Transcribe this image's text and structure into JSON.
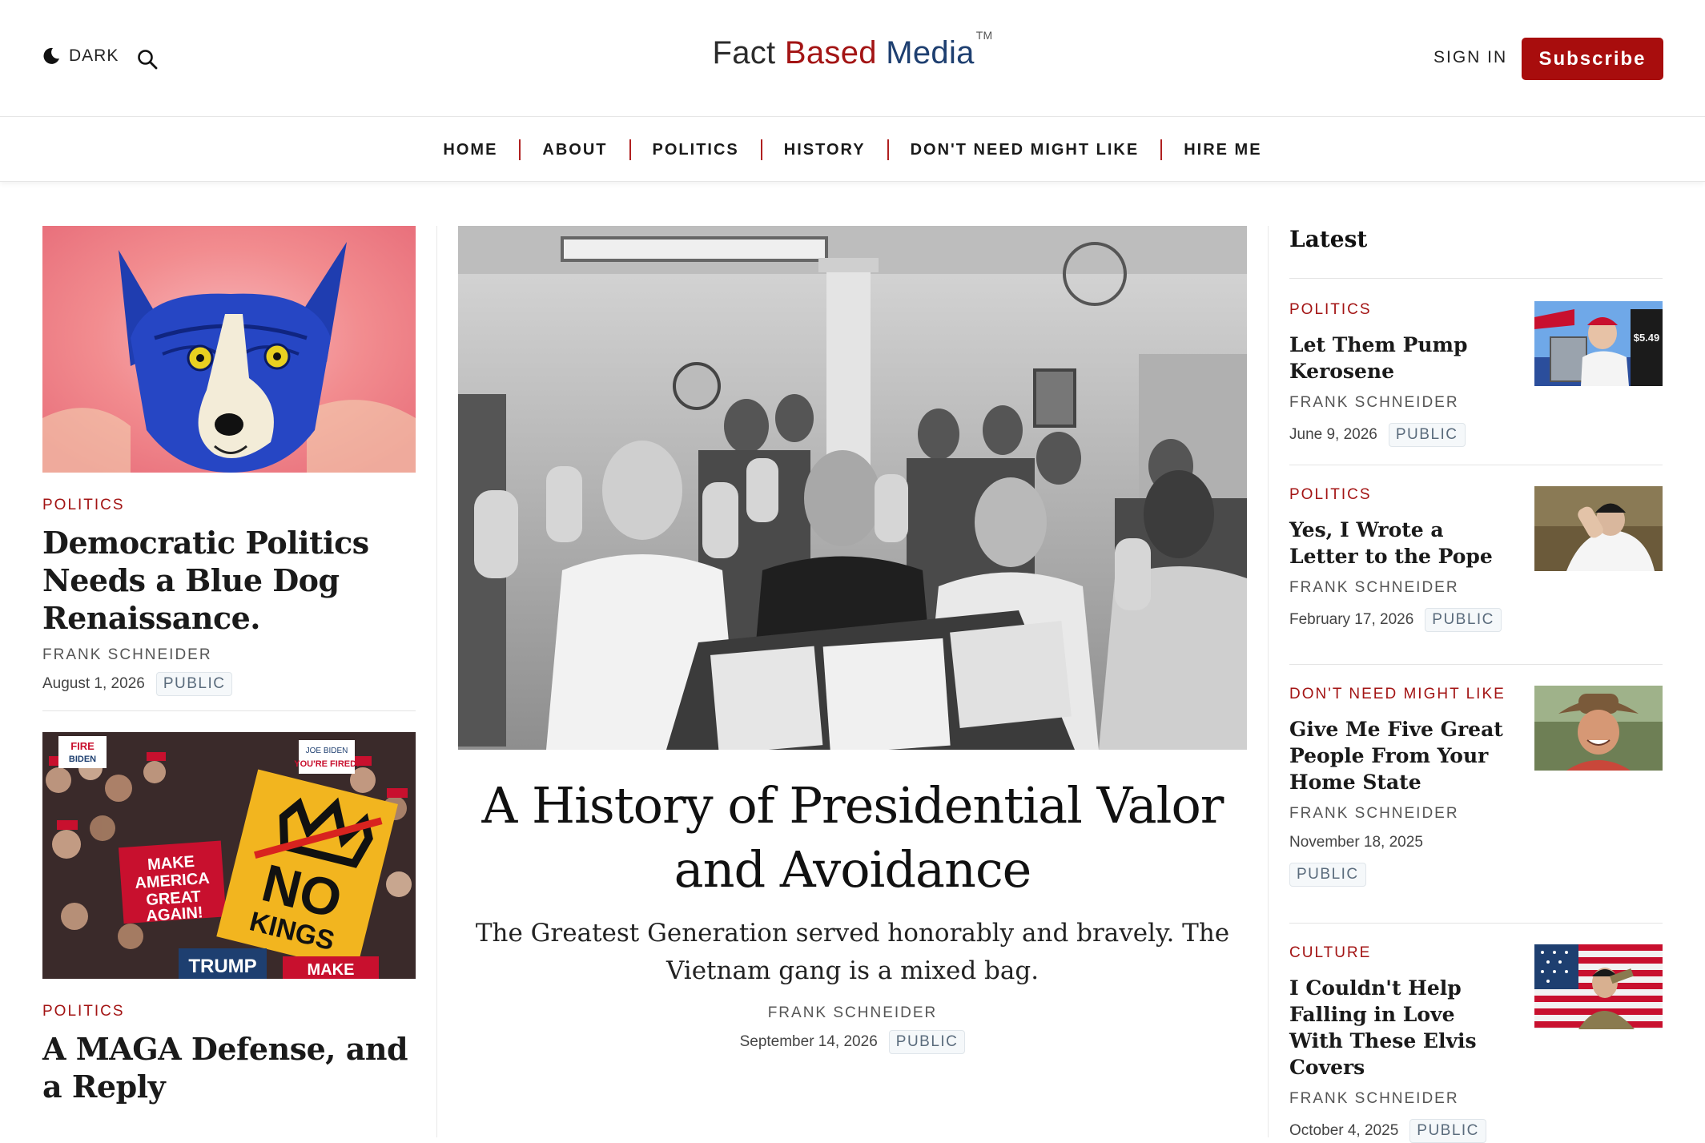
{
  "header": {
    "dark_label": "DARK",
    "logo": {
      "word1": "Fact",
      "word2": "Based",
      "word3": "Media",
      "mark": "TM"
    },
    "signin_label": "SIGN IN",
    "subscribe_label": "Subscribe"
  },
  "nav": [
    "HOME",
    "ABOUT",
    "POLITICS",
    "HISTORY",
    "DON'T NEED MIGHT LIKE",
    "HIRE ME"
  ],
  "left_articles": [
    {
      "category": "POLITICS",
      "title": "Democratic Politics Needs a Blue Dog Renaissance.",
      "author": "FRANK SCHNEIDER",
      "date": "August 1, 2026",
      "badge": "PUBLIC"
    },
    {
      "category": "POLITICS",
      "title": "A MAGA Defense, and a Reply"
    }
  ],
  "sign_text": {
    "fire": "FIRE",
    "biden": "BIDEN",
    "joe_biden": "JOE BIDEN",
    "youre_fired": "YOU'RE FIRED!",
    "maga": "MAKE AMERICA GREAT AGAIN!",
    "no": "NO",
    "kings": "KINGS",
    "trump": "TRUMP",
    "make": "MAKE"
  },
  "featured": {
    "title": "A History of Presidential Valor and Avoidance",
    "subtitle": "The Greatest Generation served honorably and bravely. The Vietnam gang is a mixed bag.",
    "author": "FRANK SCHNEIDER",
    "date": "September 14, 2026",
    "badge": "PUBLIC"
  },
  "latest": {
    "heading": "Latest",
    "items": [
      {
        "category": "POLITICS",
        "title": "Let Them Pump Kerosene",
        "author": "FRANK SCHNEIDER",
        "date": "June 9, 2026",
        "badge": "PUBLIC",
        "thumb_text": "$5.49"
      },
      {
        "category": "POLITICS",
        "title": "Yes, I Wrote a Letter to the Pope",
        "author": "FRANK SCHNEIDER",
        "date": "February 17, 2026",
        "badge": "PUBLIC"
      },
      {
        "category": "DON'T NEED MIGHT LIKE",
        "title": "Give Me Five Great People From Your Home State",
        "author": "FRANK SCHNEIDER",
        "date": "November 18, 2025",
        "badge": "PUBLIC"
      },
      {
        "category": "CULTURE",
        "title": "I Couldn't Help Falling in Love With These Elvis Covers",
        "author": "FRANK SCHNEIDER",
        "date": "October 4, 2025",
        "badge": "PUBLIC"
      }
    ]
  },
  "colors": {
    "accent_red": "#a80d0d",
    "logo_blue": "#1e3f70",
    "badge_bg": "#f5f8fa"
  }
}
